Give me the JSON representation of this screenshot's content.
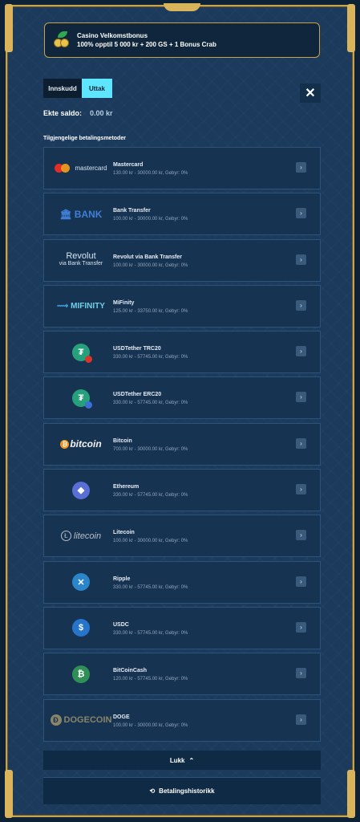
{
  "bonus": {
    "title": "Casino Velkomstbonus",
    "text": "100% opptil 5 000 kr + 200 GS + 1 Bonus Crab"
  },
  "tabs": {
    "deposit": "Innskudd",
    "withdraw": "Uttak",
    "active": "withdraw"
  },
  "close_icon": "✕",
  "balance": {
    "label": "Ekte saldo:",
    "amount": "0.00 kr"
  },
  "section_title": "Tilgjengelige betalingsmetoder",
  "methods": [
    {
      "name": "Mastercard",
      "info": "130.00 kr - 30000.00 kr,  Gebyr: 0%",
      "logo": "mastercard-logo",
      "logo_text": "mastercard"
    },
    {
      "name": "Bank Transfer",
      "info": "100.00 kr - 30000.00 kr,  Gebyr: 0%",
      "logo": "bank-logo",
      "logo_text": "BANK"
    },
    {
      "name": "Revolut via Bank Transfer",
      "info": "100.00 kr - 30000.00 kr,  Gebyr: 0%",
      "logo": "revolut-logo",
      "logo_text": "Revolut",
      "logo_subtext": "via Bank Transfer"
    },
    {
      "name": "MiFinity",
      "info": "125.00 kr - 33750.00 kr,  Gebyr: 0%",
      "logo": "mifinity-logo",
      "logo_text": "MIFINITY"
    },
    {
      "name": "USDTether TRC20",
      "info": "330.00 kr - 57745.00 kr,  Gebyr: 0%",
      "logo": "tether-trc20-icon",
      "color": "#26a17b",
      "badge_color": "#d9352b"
    },
    {
      "name": "USDTether ERC20",
      "info": "330.00 kr - 57745.00 kr,  Gebyr: 0%",
      "logo": "tether-erc20-icon",
      "color": "#26a17b",
      "badge_color": "#3b6fd6"
    },
    {
      "name": "Bitcoin",
      "info": "700.00 kr - 30000.00 kr,  Gebyr: 0%",
      "logo": "bitcoin-logo",
      "logo_text": "bitcoin"
    },
    {
      "name": "Ethereum",
      "info": "330.00 kr - 57745.00 kr,  Gebyr: 0%",
      "logo": "ethereum-icon",
      "color": "#5a6fd6"
    },
    {
      "name": "Litecoin",
      "info": "100.00 kr - 30000.00 kr,  Gebyr: 0%",
      "logo": "litecoin-logo",
      "logo_text": "litecoin"
    },
    {
      "name": "Ripple",
      "info": "330.00 kr - 57745.00 kr,  Gebyr: 0%",
      "logo": "ripple-icon",
      "color": "#2a86c8"
    },
    {
      "name": "USDC",
      "info": "330.00 kr - 57745.00 kr,  Gebyr: 0%",
      "logo": "usdc-icon",
      "color": "#2775ca"
    },
    {
      "name": "BitCoinCash",
      "info": "120.00 kr - 57745.00 kr,  Gebyr: 0%",
      "logo": "bitcoincash-icon",
      "color": "#2f8f56"
    },
    {
      "name": "DOGE",
      "info": "100.00 kr - 30000.00 kr,  Gebyr: 0%",
      "logo": "dogecoin-logo",
      "logo_text": "DOGECOIN"
    }
  ],
  "collapse_label": "Lukk",
  "history_label": "Betalingshistorikk",
  "colors": {
    "accent": "#5fe6ff",
    "gold": "#c9a24a",
    "panel": "#1b3a5c"
  }
}
